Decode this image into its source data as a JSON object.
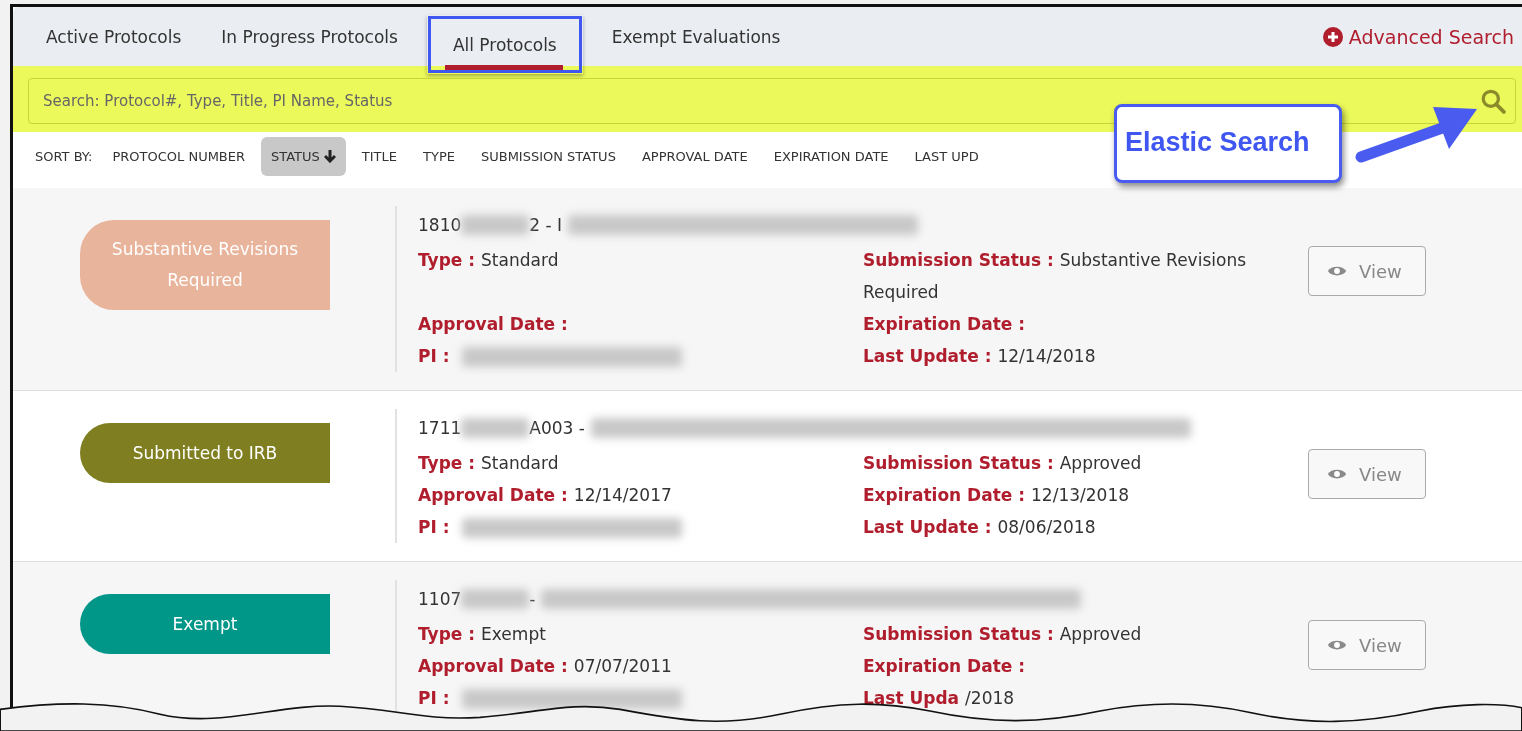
{
  "tabs": [
    {
      "label": "Active Protocols",
      "selected": false,
      "highlighted": false
    },
    {
      "label": "In Progress Protocols",
      "selected": false,
      "highlighted": false
    },
    {
      "label": "All Protocols",
      "selected": true,
      "highlighted": true
    },
    {
      "label": "Exempt Evaluations",
      "selected": false,
      "highlighted": false
    }
  ],
  "advanced_search": "Advanced Search",
  "search": {
    "placeholder": "Search: Protocol#, Type, Title, PI Name, Status",
    "highlighted": true
  },
  "sort": {
    "label": "SORT BY:",
    "options": [
      {
        "label": "PROTOCOL NUMBER",
        "selected": false
      },
      {
        "label": "STATUS",
        "selected": true
      },
      {
        "label": "TITLE",
        "selected": false
      },
      {
        "label": "TYPE",
        "selected": false
      },
      {
        "label": "SUBMISSION STATUS",
        "selected": false
      },
      {
        "label": "APPROVAL DATE",
        "selected": false
      },
      {
        "label": "EXPIRATION DATE",
        "selected": false
      },
      {
        "label": "LAST UPD",
        "selected": false
      }
    ]
  },
  "callout": {
    "text": "Elastic Search"
  },
  "protocols": [
    {
      "status": "Substantive Revisions Required",
      "color": "#e8b49b",
      "number_start": "1810",
      "number_end": "2 - I",
      "fields": [
        {
          "label": "Type :",
          "value": "Standard"
        },
        {
          "label": "Submission Status :",
          "value": "Substantive Revisions Required"
        },
        {
          "label": "Approval Date :"
        },
        {
          "label": "Expiration Date :"
        },
        {
          "label": "PI :",
          "redacted": true
        },
        {
          "label": "Last Update :",
          "value": "12/14/2018"
        }
      ],
      "button": "View"
    },
    {
      "status": "Submitted to IRB",
      "color": "#7f7f22",
      "number_start": "1711",
      "number_end": "A003 -",
      "fields": [
        {
          "label": "Type :",
          "value": "Standard"
        },
        {
          "label": "Submission Status :",
          "value": "Approved"
        },
        {
          "label": "Approval Date :",
          "value": "12/14/2017"
        },
        {
          "label": "Expiration Date :",
          "value": "12/13/2018"
        },
        {
          "label": "PI :",
          "redacted": true
        },
        {
          "label": "Last Update :",
          "value": "08/06/2018"
        }
      ],
      "button": "View"
    },
    {
      "status": "Exempt",
      "color": "#009688",
      "number_start": "1107",
      "number_end": "-",
      "fields": [
        {
          "label": "Type :",
          "value": "Exempt"
        },
        {
          "label": "Submission Status :",
          "value": "Approved"
        },
        {
          "label": "Approval Date :",
          "value": "07/07/2011"
        },
        {
          "label": "Expiration Date :"
        },
        {
          "label": "PI :",
          "redacted": true
        },
        {
          "label": "Last Upda",
          "value": "/2018"
        }
      ],
      "button": "View"
    }
  ]
}
